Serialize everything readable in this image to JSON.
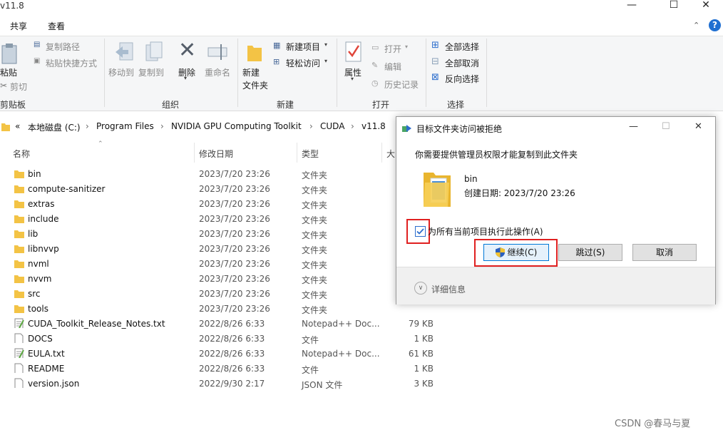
{
  "window": {
    "title": "v11.8",
    "controls": [
      "—",
      "☐",
      "✕"
    ]
  },
  "menu": {
    "share": "共享",
    "view": "查看"
  },
  "ribbon": {
    "clipboard": {
      "paste": "粘贴",
      "copy_path": "复制路径",
      "paste_shortcut": "粘贴快捷方式",
      "cut": "剪切",
      "title": "剪贴板"
    },
    "organize": {
      "move_to": "移动到",
      "copy_to": "复制到",
      "delete": "删除",
      "rename": "重命名",
      "title": "组织"
    },
    "new": {
      "new_folder": "新建\n文件夹",
      "new_item": "新建项目",
      "easy_access": "轻松访问",
      "title": "新建"
    },
    "open": {
      "properties": "属性",
      "open": "打开",
      "edit": "编辑",
      "history": "历史记录",
      "title": "打开"
    },
    "select": {
      "select_all": "全部选择",
      "select_none": "全部取消",
      "invert": "反向选择",
      "title": "选择"
    }
  },
  "address": {
    "prefix": "«",
    "crumbs": [
      "本地磁盘 (C:)",
      "Program Files",
      "NVIDIA GPU Computing Toolkit",
      "CUDA",
      "v11.8"
    ],
    "separator": "›"
  },
  "columns": {
    "name": "名称",
    "date": "修改日期",
    "type": "类型",
    "size": "大"
  },
  "files": [
    {
      "name": "bin",
      "date": "2023/7/20 23:26",
      "type": "文件夹",
      "size": "",
      "icon": "folder-icon"
    },
    {
      "name": "compute-sanitizer",
      "date": "2023/7/20 23:26",
      "type": "文件夹",
      "size": "",
      "icon": "folder-icon"
    },
    {
      "name": "extras",
      "date": "2023/7/20 23:26",
      "type": "文件夹",
      "size": "",
      "icon": "folder-icon"
    },
    {
      "name": "include",
      "date": "2023/7/20 23:26",
      "type": "文件夹",
      "size": "",
      "icon": "folder-icon"
    },
    {
      "name": "lib",
      "date": "2023/7/20 23:26",
      "type": "文件夹",
      "size": "",
      "icon": "folder-icon"
    },
    {
      "name": "libnvvp",
      "date": "2023/7/20 23:26",
      "type": "文件夹",
      "size": "",
      "icon": "folder-icon"
    },
    {
      "name": "nvml",
      "date": "2023/7/20 23:26",
      "type": "文件夹",
      "size": "",
      "icon": "folder-icon"
    },
    {
      "name": "nvvm",
      "date": "2023/7/20 23:26",
      "type": "文件夹",
      "size": "",
      "icon": "folder-icon"
    },
    {
      "name": "src",
      "date": "2023/7/20 23:26",
      "type": "文件夹",
      "size": "",
      "icon": "folder-icon"
    },
    {
      "name": "tools",
      "date": "2023/7/20 23:26",
      "type": "文件夹",
      "size": "",
      "icon": "folder-icon"
    },
    {
      "name": "CUDA_Toolkit_Release_Notes.txt",
      "date": "2022/8/26 6:33",
      "type": "Notepad++ Doc...",
      "size": "79 KB",
      "icon": "notepad-file-icon"
    },
    {
      "name": "DOCS",
      "date": "2022/8/26 6:33",
      "type": "文件",
      "size": "1 KB",
      "icon": "file-icon"
    },
    {
      "name": "EULA.txt",
      "date": "2022/8/26 6:33",
      "type": "Notepad++ Doc...",
      "size": "61 KB",
      "icon": "notepad-file-icon"
    },
    {
      "name": "README",
      "date": "2022/8/26 6:33",
      "type": "文件",
      "size": "1 KB",
      "icon": "file-icon"
    },
    {
      "name": "version.json",
      "date": "2022/9/30 2:17",
      "type": "JSON 文件",
      "size": "3 KB",
      "icon": "file-icon"
    }
  ],
  "dialog": {
    "title": "目标文件夹访问被拒绝",
    "message": "你需要提供管理员权限才能复制到此文件夹",
    "file_name": "bin",
    "file_date": "创建日期: 2023/7/20 23:26",
    "checkbox_label": "为所有当前项目执行此操作(A)",
    "checkbox_checked": true,
    "continue": "继续(C)",
    "skip": "跳过(S)",
    "cancel": "取消",
    "details": "详细信息",
    "controls": [
      "—",
      "☐",
      "✕"
    ]
  },
  "watermark": "CSDN @春马与夏",
  "colors": {
    "accent": "#0078d7",
    "highlight": "#e02020",
    "folder": "#f3c345"
  }
}
